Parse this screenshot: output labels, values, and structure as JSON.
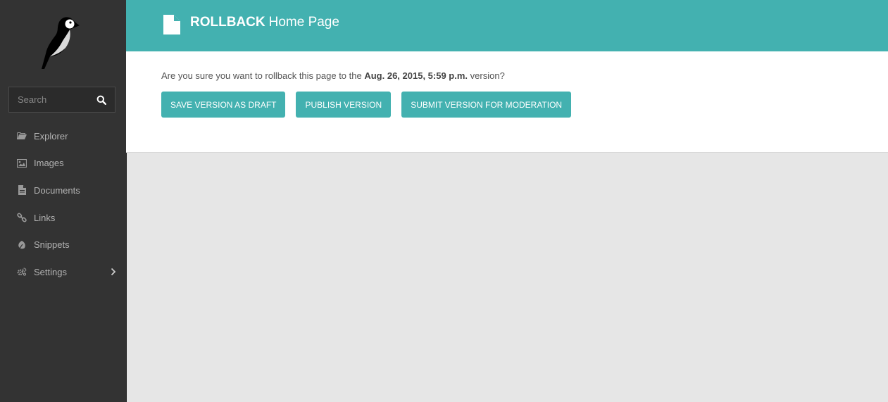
{
  "colors": {
    "sidebar_bg": "#333333",
    "accent": "#43b1b0",
    "page_bg": "#e6e6e6"
  },
  "sidebar": {
    "logo_icon": "wagtail-bird-logo",
    "search": {
      "placeholder": "Search",
      "icon": "search-icon"
    },
    "menu": [
      {
        "label": "Explorer",
        "icon": "folder-open-icon"
      },
      {
        "label": "Images",
        "icon": "image-icon"
      },
      {
        "label": "Documents",
        "icon": "document-icon"
      },
      {
        "label": "Links",
        "icon": "link-icon"
      },
      {
        "label": "Snippets",
        "icon": "snippet-icon"
      },
      {
        "label": "Settings",
        "icon": "cogs-icon",
        "submenu_icon": "chevron-right-icon"
      }
    ]
  },
  "header": {
    "icon": "document-icon",
    "action": "ROLLBACK",
    "page_title": "Home Page"
  },
  "content": {
    "confirm_prefix": "Are you sure you want to rollback this page to the",
    "confirm_version": "Aug. 26, 2015, 5:59 p.m.",
    "confirm_suffix": "version?",
    "buttons": {
      "save_draft": "Save version as draft",
      "publish": "Publish version",
      "submit_moderation": "Submit version for moderation"
    }
  }
}
